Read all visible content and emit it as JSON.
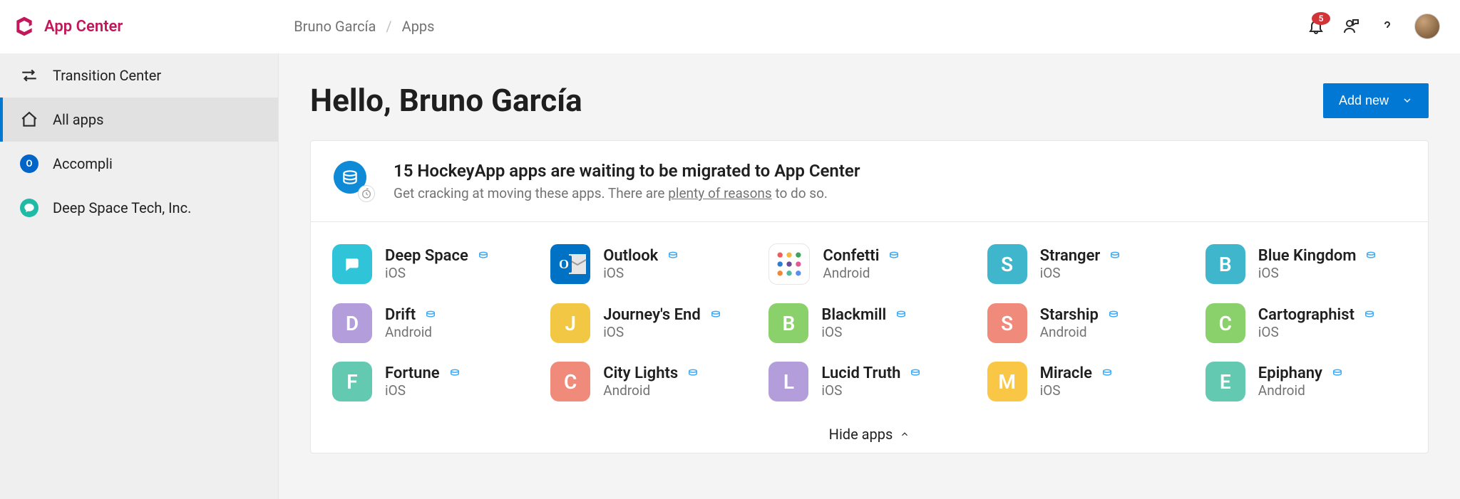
{
  "header": {
    "brand": "App Center",
    "breadcrumb": {
      "root": "Bruno García",
      "sep": "/",
      "current": "Apps"
    },
    "notifications": "5"
  },
  "sidebar": {
    "transition": "Transition Center",
    "all_apps": "All apps",
    "orgs": [
      {
        "name": "Accompli",
        "kind": "outlook",
        "initial": "O"
      },
      {
        "name": "Deep Space Tech, Inc.",
        "kind": "teal"
      }
    ]
  },
  "main": {
    "greeting": "Hello, Bruno García",
    "add_new": "Add new",
    "banner": {
      "title": "15 HockeyApp apps are waiting to be migrated to App Center",
      "sub_pre": "Get cracking at moving these apps. There are ",
      "sub_link": "plenty of reasons",
      "sub_post": " to do so."
    },
    "hide": "Hide apps",
    "apps": [
      {
        "name": "Deep Space",
        "os": "iOS",
        "icon": "deep",
        "initial": "",
        "color": "#2fc4d7"
      },
      {
        "name": "Outlook",
        "os": "iOS",
        "icon": "outlook",
        "initial": "",
        "color": "#0072c6"
      },
      {
        "name": "Confetti",
        "os": "Android",
        "icon": "confetti",
        "initial": "",
        "color": "#ffffff"
      },
      {
        "name": "Stranger",
        "os": "iOS",
        "icon": "letter",
        "initial": "S",
        "color": "#3fb6cc"
      },
      {
        "name": "Blue Kingdom",
        "os": "iOS",
        "icon": "letter",
        "initial": "B",
        "color": "#3fb6cc"
      },
      {
        "name": "Drift",
        "os": "Android",
        "icon": "letter",
        "initial": "D",
        "color": "#b39ddb"
      },
      {
        "name": "Journey's End",
        "os": "iOS",
        "icon": "letter",
        "initial": "J",
        "color": "#f2c744"
      },
      {
        "name": "Blackmill",
        "os": "iOS",
        "icon": "letter",
        "initial": "B",
        "color": "#8bd16b"
      },
      {
        "name": "Starship",
        "os": "Android",
        "icon": "letter",
        "initial": "S",
        "color": "#f08a7a"
      },
      {
        "name": "Cartographist",
        "os": "iOS",
        "icon": "letter",
        "initial": "C",
        "color": "#8bd16b"
      },
      {
        "name": "Fortune",
        "os": "iOS",
        "icon": "letter",
        "initial": "F",
        "color": "#63c9b1"
      },
      {
        "name": "City Lights",
        "os": "Android",
        "icon": "letter",
        "initial": "C",
        "color": "#f08a7a"
      },
      {
        "name": "Lucid Truth",
        "os": "iOS",
        "icon": "letter",
        "initial": "L",
        "color": "#b39ddb"
      },
      {
        "name": "Miracle",
        "os": "iOS",
        "icon": "letter",
        "initial": "M",
        "color": "#f9c646"
      },
      {
        "name": "Epiphany",
        "os": "Android",
        "icon": "letter",
        "initial": "E",
        "color": "#63c9b1"
      }
    ]
  }
}
